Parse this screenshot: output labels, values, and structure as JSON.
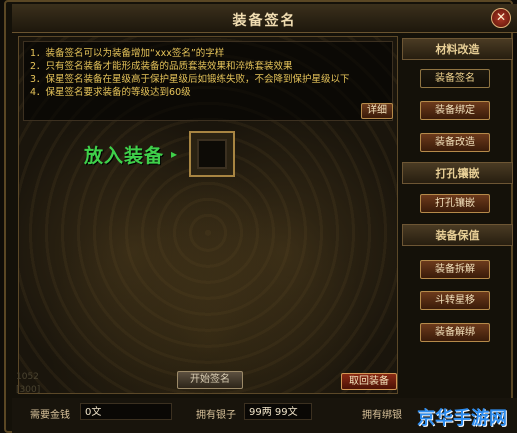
{
  "window": {
    "title": "装备签名",
    "close_label": "✕"
  },
  "info": {
    "lines": [
      "1．装备签名可以为装备增加“xxx签名”的字样",
      "2．只有签名装备才能形成装备的品质套装效果和淬炼套装效果",
      "3．保星签名装备在星级高于保护星级后如锻练失败，不会降到保护星级以下",
      "4．保星签名要求装备的等级达到60级"
    ],
    "detail_label": "详细"
  },
  "slot": {
    "label": "放入装备",
    "arrow": "▸"
  },
  "actions": {
    "start_label": "开始签名",
    "retrieve_label": "取回装备"
  },
  "sidebar": {
    "sections": [
      {
        "title": "材料改造",
        "items": [
          "装备签名",
          "装备绑定",
          "装备改造"
        ]
      },
      {
        "title": "打孔镶嵌",
        "items": [
          "打孔镶嵌"
        ]
      },
      {
        "title": "装备保值",
        "items": [
          "装备拆解",
          "斗转星移",
          "装备解绑"
        ]
      }
    ]
  },
  "status": {
    "required_gold_label": "需要金钱",
    "required_gold_value": "0文",
    "owned_silver_label": "拥有银子",
    "owned_silver_value": "99两 99文",
    "owned_bound_label": "拥有绑银",
    "faded_left_1": "1052",
    "faded_left_2": "[300]"
  },
  "watermark": "京华手游网"
}
